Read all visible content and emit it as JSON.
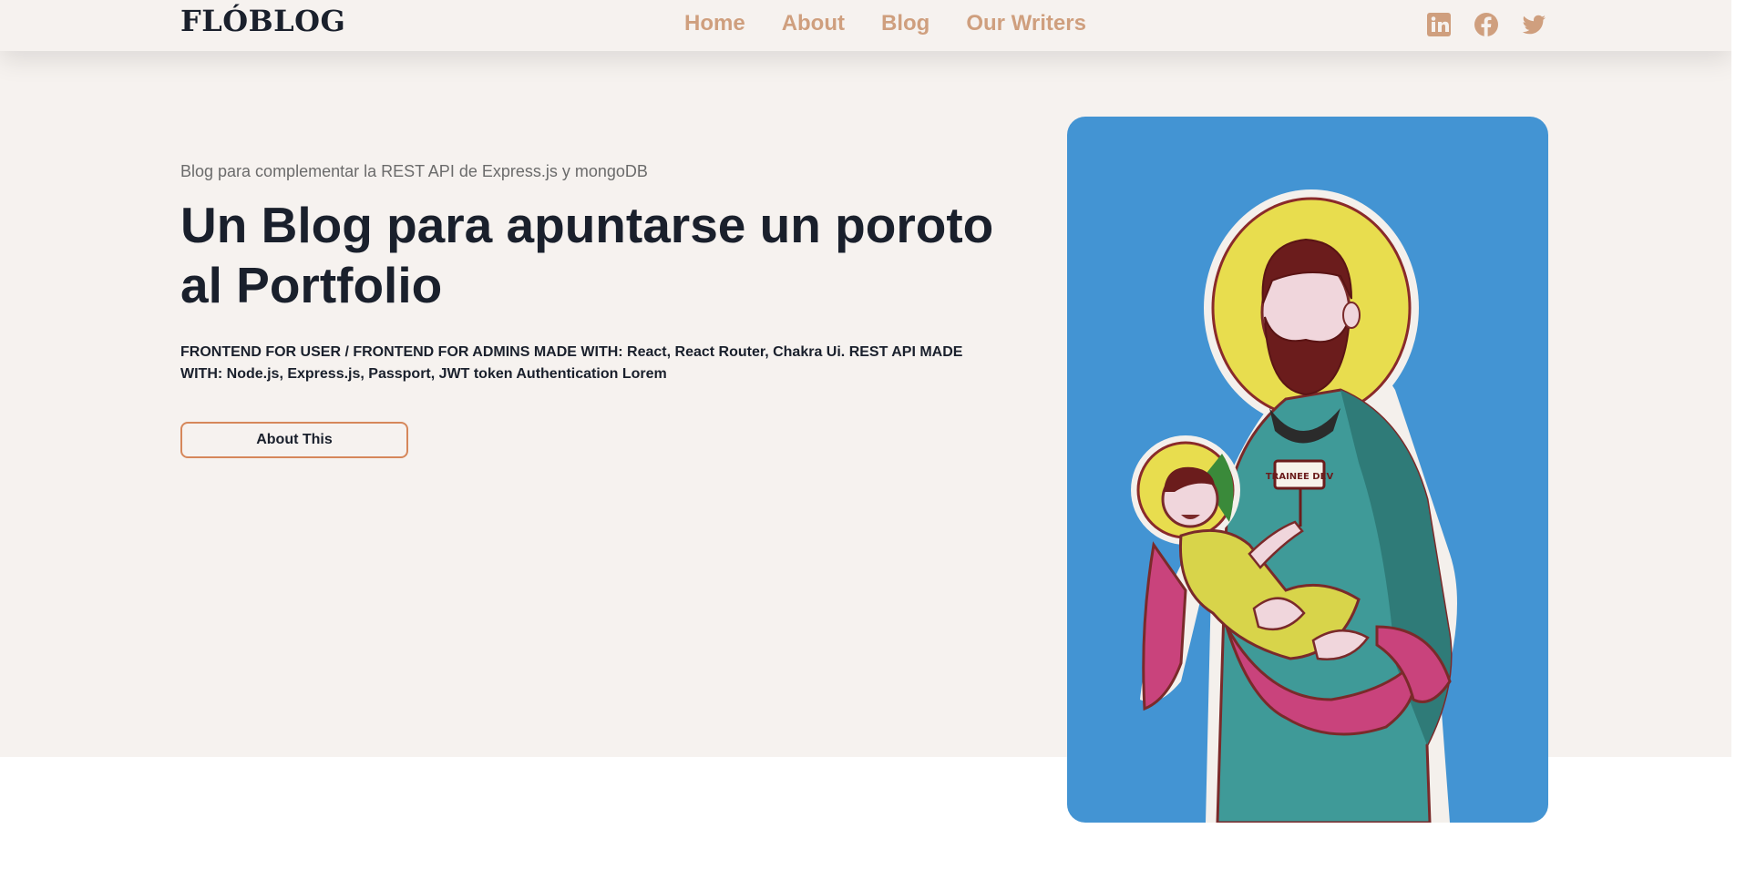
{
  "nav": {
    "logo": "FLÓBLOG",
    "links": [
      "Home",
      "About",
      "Blog",
      "Our Writers"
    ],
    "socials": [
      "linkedin-icon",
      "facebook-icon",
      "twitter-icon"
    ]
  },
  "hero": {
    "tagline": "Blog para complementar la REST API de Express.js y mongoDB",
    "headline": "Un Blog para apuntarse un poroto al Portfolio",
    "description": "FRONTEND FOR USER / FRONTEND FOR ADMINS MADE WITH: React, React Router, Chakra Ui. REST API MADE WITH: Node.js, Express.js, Passport, JWT token Authentication Lorem",
    "button_label": "About This"
  },
  "illustration": {
    "sign_text": "TRAINEE DEV"
  },
  "colors": {
    "background": "#f6f2ef",
    "nav_link": "#cf9f7e",
    "button_border": "#d6875a",
    "illustration_bg": "#4394d3"
  }
}
